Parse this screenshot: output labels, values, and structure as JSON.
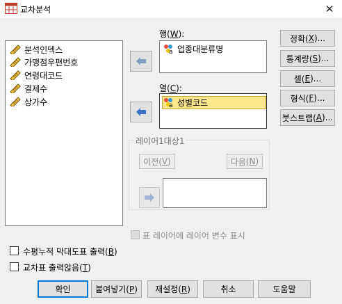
{
  "window": {
    "title": "교차분석"
  },
  "variables": {
    "items": [
      {
        "label": "분석인덱스"
      },
      {
        "label": "가맹점우편번호"
      },
      {
        "label": "연령대코드"
      },
      {
        "label": "결제수"
      },
      {
        "label": "상가수"
      }
    ]
  },
  "row": {
    "label_prefix": "행(",
    "label_key": "W",
    "label_suffix": "):",
    "items": [
      {
        "label": "업종대분류명"
      }
    ]
  },
  "column": {
    "label_prefix": "열(",
    "label_key": "C",
    "label_suffix": "):",
    "items": [
      {
        "label": "성별코드"
      }
    ]
  },
  "layer": {
    "title": "레이어1대상1",
    "prev_label": "이전(",
    "prev_key": "V",
    "prev_suffix": ")",
    "next_label": "다음(",
    "next_key": "N",
    "next_suffix": ")"
  },
  "layer_option": {
    "label": "표 레이어에 레이어 변수 표시"
  },
  "options": {
    "clustered_bar": {
      "prefix": "수평누적 막대도표 출력(",
      "key": "B",
      "suffix": ")"
    },
    "suppress_tables": {
      "prefix": "교차표 출력않음(",
      "key": "T",
      "suffix": ")"
    }
  },
  "side_buttons": [
    {
      "prefix": "정확(",
      "key": "X",
      "suffix": ")..."
    },
    {
      "prefix": "통계량(",
      "key": "S",
      "suffix": ")..."
    },
    {
      "prefix": "셀(",
      "key": "E",
      "suffix": ")..."
    },
    {
      "prefix": "형식(",
      "key": "F",
      "suffix": ")..."
    },
    {
      "prefix": "붓스트랩(",
      "key": "A",
      "suffix": ")..."
    }
  ],
  "bottom_buttons": {
    "ok": {
      "label": "확인"
    },
    "paste": {
      "prefix": "붙여넣기(",
      "key": "P",
      "suffix": ")"
    },
    "reset": {
      "prefix": "재설정(",
      "key": "R",
      "suffix": ")"
    },
    "cancel": {
      "label": "취소"
    },
    "help": {
      "label": "도움말"
    }
  },
  "colors": {
    "accent": "#0078d7",
    "selection": "#ffe88c",
    "arrow_blue": "#3a6fc4"
  }
}
